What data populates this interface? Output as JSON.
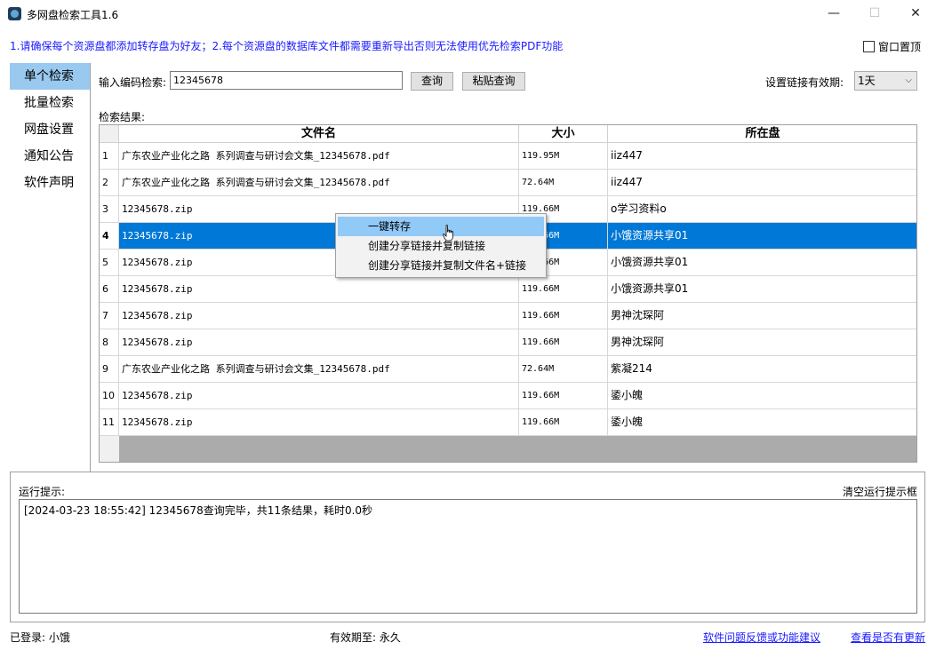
{
  "window": {
    "title": "多网盘检索工具1.6",
    "minimize": "—",
    "maximize": "☐",
    "close": "✕"
  },
  "notice": "1.请确保每个资源盘都添加转存盘为好友；2.每个资源盘的数据库文件都需要重新导出否则无法使用优先检索PDF功能",
  "always_on_top_label": "窗口置顶",
  "nav": {
    "items": [
      {
        "label": "单个检索",
        "active": true
      },
      {
        "label": "批量检索",
        "active": false
      },
      {
        "label": "网盘设置",
        "active": false
      },
      {
        "label": "通知公告",
        "active": false
      },
      {
        "label": "软件声明",
        "active": false
      }
    ]
  },
  "search": {
    "label": "输入编码检索:",
    "value": "12345678",
    "query_button": "查询",
    "paste_button": "粘贴查询",
    "expiry_label": "设置链接有效期:",
    "expiry_value": "1天",
    "results_label": "检索结果:"
  },
  "table": {
    "columns": [
      "文件名",
      "大小",
      "所在盘"
    ],
    "rows": [
      {
        "idx": "1",
        "name": "广东农业产业化之路  系列调查与研讨会文集_12345678.pdf",
        "size": "119.95M",
        "drive": "iiz447"
      },
      {
        "idx": "2",
        "name": "广东农业产业化之路  系列调查与研讨会文集_12345678.pdf",
        "size": "72.64M",
        "drive": "iiz447"
      },
      {
        "idx": "3",
        "name": "12345678.zip",
        "size": "119.66M",
        "drive": "o学习资料o"
      },
      {
        "idx": "4",
        "name": "12345678.zip",
        "size": "119.66M",
        "drive": "小饿资源共享01"
      },
      {
        "idx": "5",
        "name": "12345678.zip",
        "size": "119.66M",
        "drive": "小饿资源共享01"
      },
      {
        "idx": "6",
        "name": "12345678.zip",
        "size": "119.66M",
        "drive": "小饿资源共享01"
      },
      {
        "idx": "7",
        "name": "12345678.zip",
        "size": "119.66M",
        "drive": "男神沈琛阿"
      },
      {
        "idx": "8",
        "name": "12345678.zip",
        "size": "119.66M",
        "drive": "男神沈琛阿"
      },
      {
        "idx": "9",
        "name": "广东农业产业化之路  系列调查与研讨会文集_12345678.pdf",
        "size": "72.64M",
        "drive": "紫凝214"
      },
      {
        "idx": "10",
        "name": "12345678.zip",
        "size": "119.66M",
        "drive": "鋈小魄"
      },
      {
        "idx": "11",
        "name": "12345678.zip",
        "size": "119.66M",
        "drive": "鋈小魄"
      }
    ],
    "selected_row": "4"
  },
  "context_menu": {
    "items": [
      {
        "label": "一键转存",
        "hover": true
      },
      {
        "label": "创建分享链接并复制链接",
        "hover": false
      },
      {
        "label": "创建分享链接并复制文件名+链接",
        "hover": false
      }
    ]
  },
  "log": {
    "label": "运行提示:",
    "clear_label": "清空运行提示框",
    "content": "[2024-03-23 18:55:42] 12345678查询完毕，共11条结果，耗时0.0秒"
  },
  "status": {
    "logged_in": "已登录: 小饿",
    "valid_until": "有效期至: 永久",
    "feedback_link": "软件问题反馈或功能建议",
    "update_link": "查看是否有更新"
  },
  "colors": {
    "nav_active": "#99c9ef",
    "row_selected": "#0078d7",
    "menu_hover": "#91c9f7",
    "link": "#1a1aff"
  }
}
